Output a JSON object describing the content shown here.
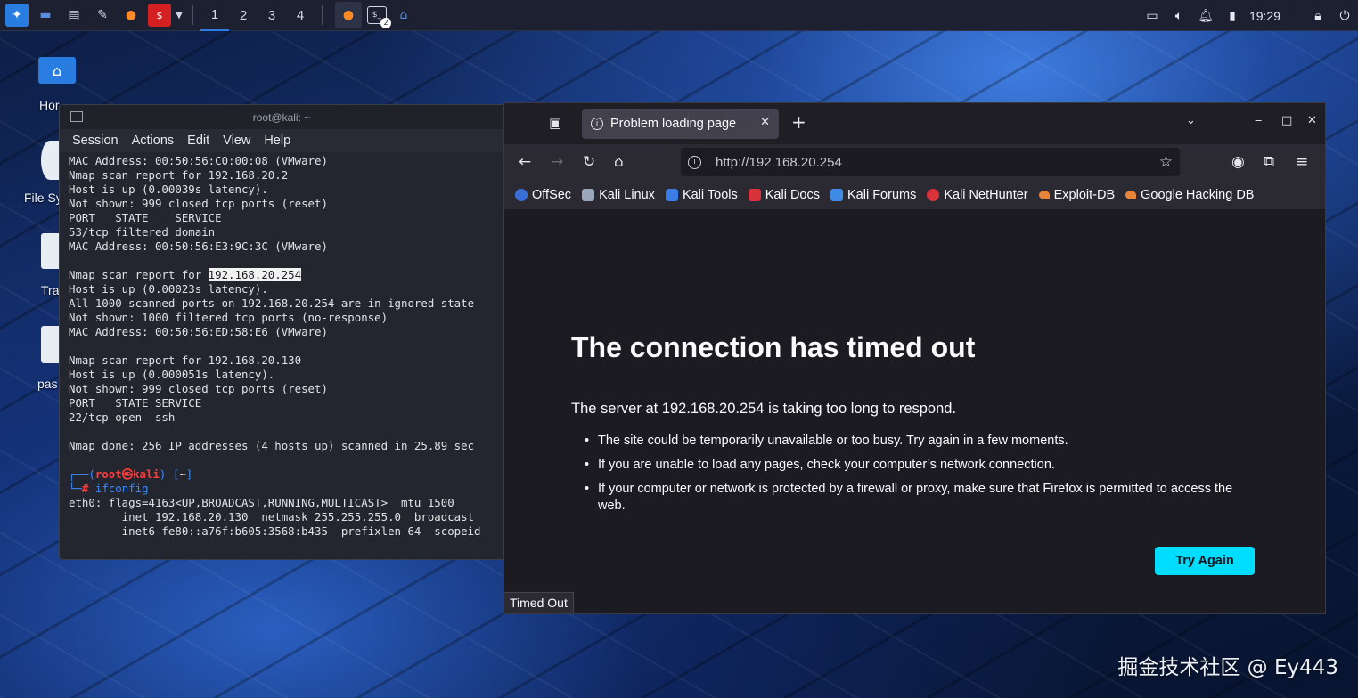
{
  "taskbar": {
    "workspaces": [
      "1",
      "2",
      "3",
      "4"
    ],
    "clock": "19:29",
    "terminal_badge": "2"
  },
  "desktop": {
    "icons": [
      "Hor",
      "File Sy",
      "Tra",
      "pas"
    ]
  },
  "terminal": {
    "title": "root@kali: ~",
    "menu": [
      "Session",
      "Actions",
      "Edit",
      "View",
      "Help"
    ],
    "lines": [
      "MAC Address: 00:50:56:C0:00:08 (VMware)",
      "",
      "Nmap scan report for 192.168.20.2",
      "Host is up (0.00039s latency).",
      "Not shown: 999 closed tcp ports (reset)",
      "PORT   STATE    SERVICE",
      "53/tcp filtered domain",
      "MAC Address: 00:50:56:E3:9C:3C (VMware)",
      "",
      "Host is up (0.00023s latency).",
      "All 1000 scanned ports on 192.168.20.254 are in ignored state",
      "Not shown: 1000 filtered tcp ports (no-response)",
      "MAC Address: 00:50:56:ED:58:E6 (VMware)",
      "",
      "Nmap scan report for 192.168.20.130",
      "Host is up (0.000051s latency).",
      "Not shown: 999 closed tcp ports (reset)",
      "PORT   STATE SERVICE",
      "22/tcp open  ssh",
      "",
      "Nmap done: 256 IP addresses (4 hosts up) scanned in 25.89 sec",
      "",
      "eth0: flags=4163<UP,BROADCAST,RUNNING,MULTICAST>  mtu 1500",
      "        inet 192.168.20.130  netmask 255.255.255.0  broadcast",
      "        inet6 fe80::a76f:b605:3568:b435  prefixlen 64  scopeid"
    ],
    "highlight_prefix": "Nmap scan report for ",
    "highlight_ip": "192.168.20.254",
    "prompt_user": "root",
    "prompt_at": "㉿",
    "prompt_host": "kali",
    "prompt_dir": "~",
    "command": "ifconfig"
  },
  "firefox": {
    "tab_title": "Problem loading page",
    "url": "http://192.168.20.254",
    "bookmarks": [
      {
        "label": "OffSec",
        "color": "#3a6fd8"
      },
      {
        "label": "Kali Linux",
        "color": "#9aa7bb"
      },
      {
        "label": "Kali Tools",
        "color": "#3d7ce6"
      },
      {
        "label": "Kali Docs",
        "color": "#d8323a"
      },
      {
        "label": "Kali Forums",
        "color": "#3f8be8"
      },
      {
        "label": "Kali NetHunter",
        "color": "#d8323a"
      },
      {
        "label": "Exploit-DB",
        "color": "#e8843a"
      },
      {
        "label": "Google Hacking DB",
        "color": "#e8843a"
      }
    ],
    "error_title": "The connection has timed out",
    "error_desc": "The server at 192.168.20.254 is taking too long to respond.",
    "error_items": [
      "The site could be temporarily unavailable or too busy. Try again in a few moments.",
      "If you are unable to load any pages, check your computer’s network connection.",
      "If your computer or network is protected by a firewall or proxy, make sure that Firefox is permitted to access the web."
    ],
    "try_again": "Try Again",
    "status": "Timed Out"
  },
  "watermark": "掘金技术社区 @ Ey443"
}
